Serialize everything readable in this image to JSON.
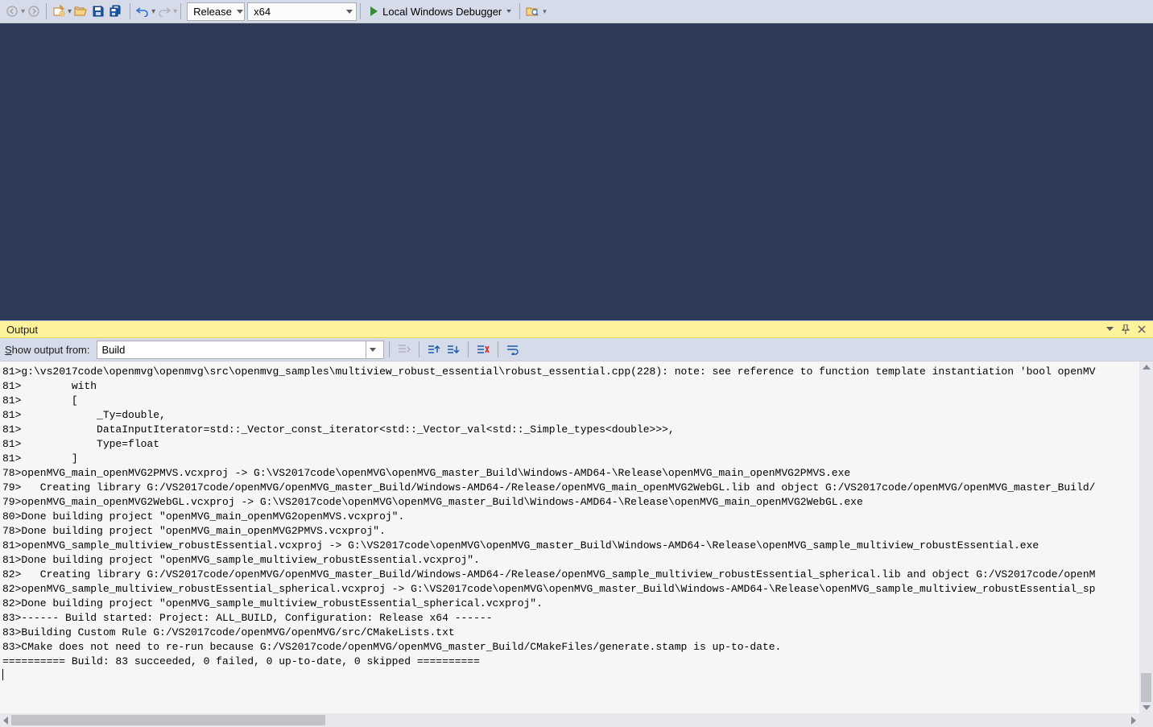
{
  "toolbar": {
    "config": "Release",
    "platform": "x64",
    "debugger_label": "Local Windows Debugger"
  },
  "output_panel": {
    "title": "Output",
    "show_from_label_pre": "S",
    "show_from_label_ul": "how output from:",
    "source_selected": "Build",
    "lines": [
      "81>g:\\vs2017code\\openmvg\\openmvg\\src\\openmvg_samples\\multiview_robust_essential\\robust_essential.cpp(228): note: see reference to function template instantiation 'bool openMV",
      "81>        with",
      "81>        [",
      "81>            _Ty=double,",
      "81>            DataInputIterator=std::_Vector_const_iterator<std::_Vector_val<std::_Simple_types<double>>>,",
      "81>            Type=float",
      "81>        ]",
      "78>openMVG_main_openMVG2PMVS.vcxproj -> G:\\VS2017code\\openMVG\\openMVG_master_Build\\Windows-AMD64-\\Release\\openMVG_main_openMVG2PMVS.exe",
      "79>   Creating library G:/VS2017code/openMVG/openMVG_master_Build/Windows-AMD64-/Release/openMVG_main_openMVG2WebGL.lib and object G:/VS2017code/openMVG/openMVG_master_Build/",
      "79>openMVG_main_openMVG2WebGL.vcxproj -> G:\\VS2017code\\openMVG\\openMVG_master_Build\\Windows-AMD64-\\Release\\openMVG_main_openMVG2WebGL.exe",
      "80>Done building project \"openMVG_main_openMVG2openMVS.vcxproj\".",
      "78>Done building project \"openMVG_main_openMVG2PMVS.vcxproj\".",
      "81>openMVG_sample_multiview_robustEssential.vcxproj -> G:\\VS2017code\\openMVG\\openMVG_master_Build\\Windows-AMD64-\\Release\\openMVG_sample_multiview_robustEssential.exe",
      "81>Done building project \"openMVG_sample_multiview_robustEssential.vcxproj\".",
      "82>   Creating library G:/VS2017code/openMVG/openMVG_master_Build/Windows-AMD64-/Release/openMVG_sample_multiview_robustEssential_spherical.lib and object G:/VS2017code/openM",
      "82>openMVG_sample_multiview_robustEssential_spherical.vcxproj -> G:\\VS2017code\\openMVG\\openMVG_master_Build\\Windows-AMD64-\\Release\\openMVG_sample_multiview_robustEssential_sp",
      "82>Done building project \"openMVG_sample_multiview_robustEssential_spherical.vcxproj\".",
      "83>------ Build started: Project: ALL_BUILD, Configuration: Release x64 ------",
      "83>Building Custom Rule G:/VS2017code/openMVG/openMVG/src/CMakeLists.txt",
      "83>CMake does not need to re-run because G:/VS2017code/openMVG/openMVG_master_Build/CMakeFiles/generate.stamp is up-to-date.",
      "========== Build: 83 succeeded, 0 failed, 0 up-to-date, 0 skipped =========="
    ]
  }
}
